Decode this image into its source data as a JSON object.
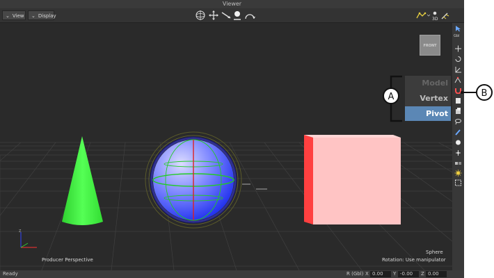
{
  "window": {
    "title": "Viewer"
  },
  "toolbar": {
    "view_menu": "View",
    "display_menu": "Display",
    "right_text": "3D"
  },
  "viewport": {
    "view_cube_label": "FRONT",
    "camera_name": "Producer Perspective",
    "selected_object": "Sphere",
    "rotation_status": "Rotation: Use manipulator"
  },
  "snap_menu": {
    "items": [
      {
        "label": "Model",
        "state": "disabled"
      },
      {
        "label": "Vertex",
        "state": "normal"
      },
      {
        "label": "Pivot",
        "state": "selected"
      }
    ]
  },
  "callouts": {
    "a": "A",
    "b": "B"
  },
  "rightbar": {
    "gbl_label": "Gbl"
  },
  "statusbar": {
    "status": "Ready",
    "coord_label": "R (Gbl)",
    "x_label": "X",
    "x_value": "0.00",
    "y_label": "Y",
    "y_value": "-0.00",
    "z_label": "Z",
    "z_value": "0.00"
  },
  "colors": {
    "selected_bg": "#5b87b5",
    "cone": "#44ee44",
    "cube_front": "#ffc2c2",
    "cube_side": "#ff4040",
    "sphere": "#5566ff"
  }
}
